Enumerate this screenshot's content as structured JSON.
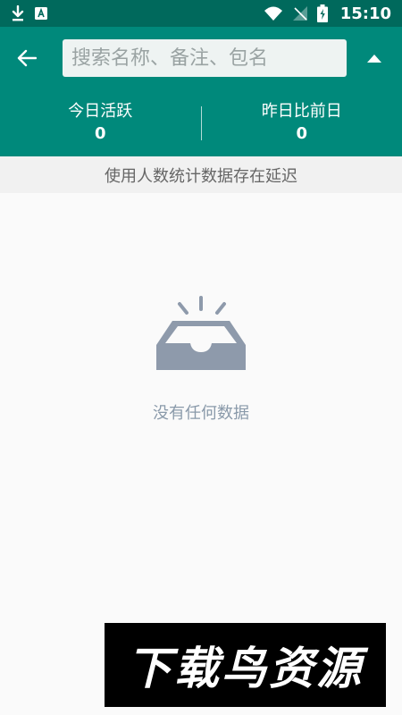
{
  "status_bar": {
    "time": "15:10",
    "icons": [
      "download-icon",
      "app-notification-icon",
      "wifi-icon",
      "signal-icon",
      "battery-charging-icon"
    ]
  },
  "header": {
    "back_icon": "arrow-left-icon",
    "search_placeholder": "搜索名称、备注、包名",
    "search_value": "",
    "collapse_icon": "triangle-up-icon"
  },
  "stats": [
    {
      "label": "今日活跃",
      "value": "0"
    },
    {
      "label": "昨日比前日",
      "value": "0"
    }
  ],
  "notice": "使用人数统计数据存在延迟",
  "empty_state": {
    "icon": "empty-inbox-icon",
    "text": "没有任何数据"
  },
  "watermark": "下载鸟资源",
  "colors": {
    "status_bar": "#00695c",
    "primary": "#00897b",
    "empty_icon": "#8e9aab",
    "notice_bg": "#f1f1f1"
  }
}
